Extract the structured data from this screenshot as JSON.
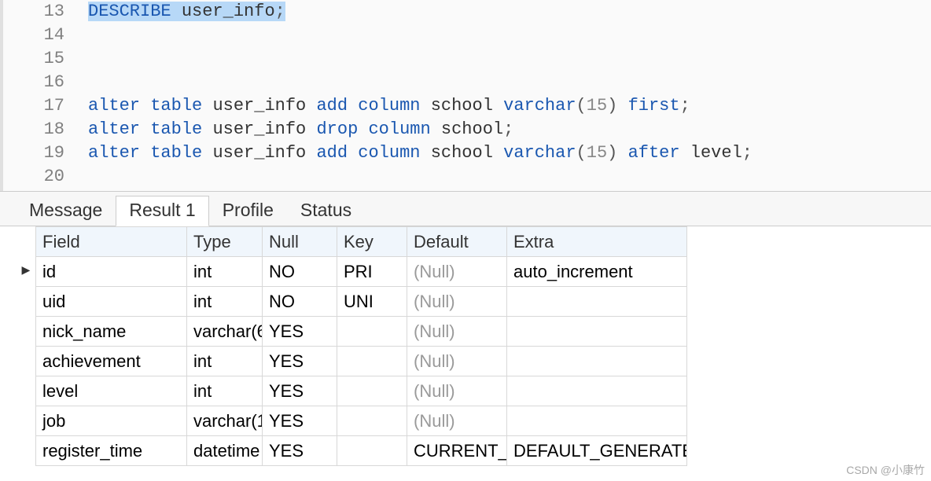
{
  "code": {
    "lines": [
      {
        "num": "13",
        "tokens": [
          {
            "t": "DESCRIBE",
            "cls": "kw",
            "hl": true
          },
          {
            "t": " ",
            "cls": "",
            "hl": true
          },
          {
            "t": "user_info",
            "cls": "ident",
            "hl": true
          },
          {
            "t": ";",
            "cls": "punct",
            "hl": true
          }
        ],
        "lineHighlight": true
      },
      {
        "num": "14",
        "tokens": []
      },
      {
        "num": "15",
        "tokens": []
      },
      {
        "num": "16",
        "tokens": []
      },
      {
        "num": "17",
        "tokens": [
          {
            "t": "alter",
            "cls": "kw"
          },
          {
            "t": " "
          },
          {
            "t": "table",
            "cls": "kw"
          },
          {
            "t": " "
          },
          {
            "t": "user_info",
            "cls": "ident"
          },
          {
            "t": " "
          },
          {
            "t": "add",
            "cls": "kw"
          },
          {
            "t": " "
          },
          {
            "t": "column",
            "cls": "kw"
          },
          {
            "t": " "
          },
          {
            "t": "school",
            "cls": "ident"
          },
          {
            "t": " "
          },
          {
            "t": "varchar",
            "cls": "kw"
          },
          {
            "t": "(",
            "cls": "punct"
          },
          {
            "t": "15",
            "cls": "num"
          },
          {
            "t": ")",
            "cls": "punct"
          },
          {
            "t": " "
          },
          {
            "t": "first",
            "cls": "kw"
          },
          {
            "t": ";",
            "cls": "punct"
          }
        ]
      },
      {
        "num": "18",
        "tokens": [
          {
            "t": "alter",
            "cls": "kw"
          },
          {
            "t": " "
          },
          {
            "t": "table",
            "cls": "kw"
          },
          {
            "t": " "
          },
          {
            "t": "user_info",
            "cls": "ident"
          },
          {
            "t": " "
          },
          {
            "t": "drop",
            "cls": "kw"
          },
          {
            "t": " "
          },
          {
            "t": "column",
            "cls": "kw"
          },
          {
            "t": " "
          },
          {
            "t": "school",
            "cls": "ident"
          },
          {
            "t": ";",
            "cls": "punct"
          }
        ]
      },
      {
        "num": "19",
        "tokens": [
          {
            "t": "alter",
            "cls": "kw"
          },
          {
            "t": " "
          },
          {
            "t": "table",
            "cls": "kw"
          },
          {
            "t": " "
          },
          {
            "t": "user_info",
            "cls": "ident"
          },
          {
            "t": " "
          },
          {
            "t": "add",
            "cls": "kw"
          },
          {
            "t": " "
          },
          {
            "t": "column",
            "cls": "kw"
          },
          {
            "t": " "
          },
          {
            "t": "school",
            "cls": "ident"
          },
          {
            "t": " "
          },
          {
            "t": "varchar",
            "cls": "kw"
          },
          {
            "t": "(",
            "cls": "punct"
          },
          {
            "t": "15",
            "cls": "num"
          },
          {
            "t": ")",
            "cls": "punct"
          },
          {
            "t": " "
          },
          {
            "t": "after",
            "cls": "kw"
          },
          {
            "t": " "
          },
          {
            "t": "level",
            "cls": "ident"
          },
          {
            "t": ";",
            "cls": "punct"
          }
        ]
      },
      {
        "num": "20",
        "tokens": []
      }
    ]
  },
  "tabs": {
    "items": [
      "Message",
      "Result 1",
      "Profile",
      "Status"
    ],
    "activeIndex": 1
  },
  "result": {
    "headers": [
      "Field",
      "Type",
      "Null",
      "Key",
      "Default",
      "Extra"
    ],
    "colClasses": [
      "col-field",
      "col-type",
      "col-null",
      "col-key",
      "col-default",
      "col-extra"
    ],
    "currentRowIndex": 0,
    "rows": [
      {
        "cells": [
          "id",
          "int",
          "NO",
          "PRI",
          "(Null)",
          "auto_increment"
        ],
        "nullCol": 4
      },
      {
        "cells": [
          "uid",
          "int",
          "NO",
          "UNI",
          "(Null)",
          ""
        ],
        "nullCol": 4
      },
      {
        "cells": [
          "nick_name",
          "varchar(6",
          "YES",
          "",
          "(Null)",
          ""
        ],
        "nullCol": 4
      },
      {
        "cells": [
          "achievement",
          "int",
          "YES",
          "",
          "(Null)",
          ""
        ],
        "nullCol": 4
      },
      {
        "cells": [
          "level",
          "int",
          "YES",
          "",
          "(Null)",
          ""
        ],
        "nullCol": 4
      },
      {
        "cells": [
          "job",
          "varchar(1",
          "YES",
          "",
          "(Null)",
          ""
        ],
        "nullCol": 4
      },
      {
        "cells": [
          "register_time",
          "datetime",
          "YES",
          "",
          "CURRENT_",
          "DEFAULT_GENERATE"
        ],
        "nullCol": -1
      }
    ]
  },
  "watermark": "CSDN @小康竹"
}
